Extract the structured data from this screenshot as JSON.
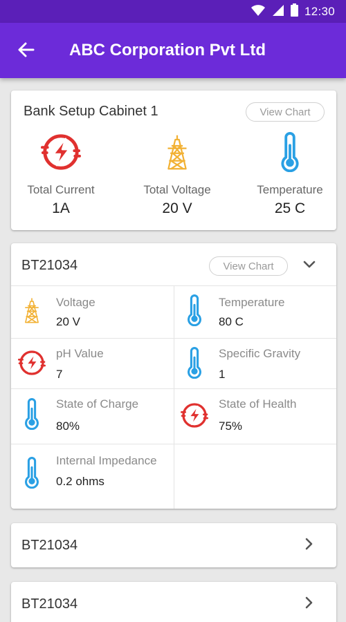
{
  "status_bar": {
    "time": "12:30",
    "icons": [
      "wifi-icon",
      "signal-icon",
      "battery-icon"
    ]
  },
  "app_bar": {
    "title": "ABC Corporation Pvt Ltd",
    "back_icon": "arrow-left-icon"
  },
  "cabinet": {
    "title": "Bank Setup Cabinet 1",
    "view_chart_label": "View Chart",
    "metrics": [
      {
        "label": "Total Current",
        "value": "1A",
        "icon": "lightning-icon"
      },
      {
        "label": "Total Voltage",
        "value": "20 V",
        "icon": "tower-icon"
      },
      {
        "label": "Temperature",
        "value": "25 C",
        "icon": "thermometer-icon"
      }
    ]
  },
  "battery_expanded": {
    "title": "BT21034",
    "view_chart_label": "View Chart",
    "toggle_icon": "chevron-down-icon",
    "readings": [
      {
        "label": "Voltage",
        "value": "20 V",
        "icon": "tower-icon"
      },
      {
        "label": "Temperature",
        "value": "80 C",
        "icon": "thermometer-icon"
      },
      {
        "label": "pH Value",
        "value": "7",
        "icon": "lightning-icon"
      },
      {
        "label": "Specific Gravity",
        "value": "1",
        "icon": "thermometer-icon"
      },
      {
        "label": "State of Charge",
        "value": "80%",
        "icon": "thermometer-icon"
      },
      {
        "label": "State of Health",
        "value": "75%",
        "icon": "lightning-icon"
      },
      {
        "label": "Internal Impedance",
        "value": "0.2 ohms",
        "icon": "thermometer-icon"
      }
    ]
  },
  "battery_list": [
    {
      "title": "BT21034",
      "icon": "chevron-right-icon"
    },
    {
      "title": "BT21034",
      "icon": "chevron-right-icon"
    }
  ],
  "colors": {
    "status_bar": "#5b1fb8",
    "app_bar": "#6c2bd9",
    "lightning": "#e0312f",
    "tower": "#f2b134",
    "thermometer": "#2aa0e4"
  }
}
